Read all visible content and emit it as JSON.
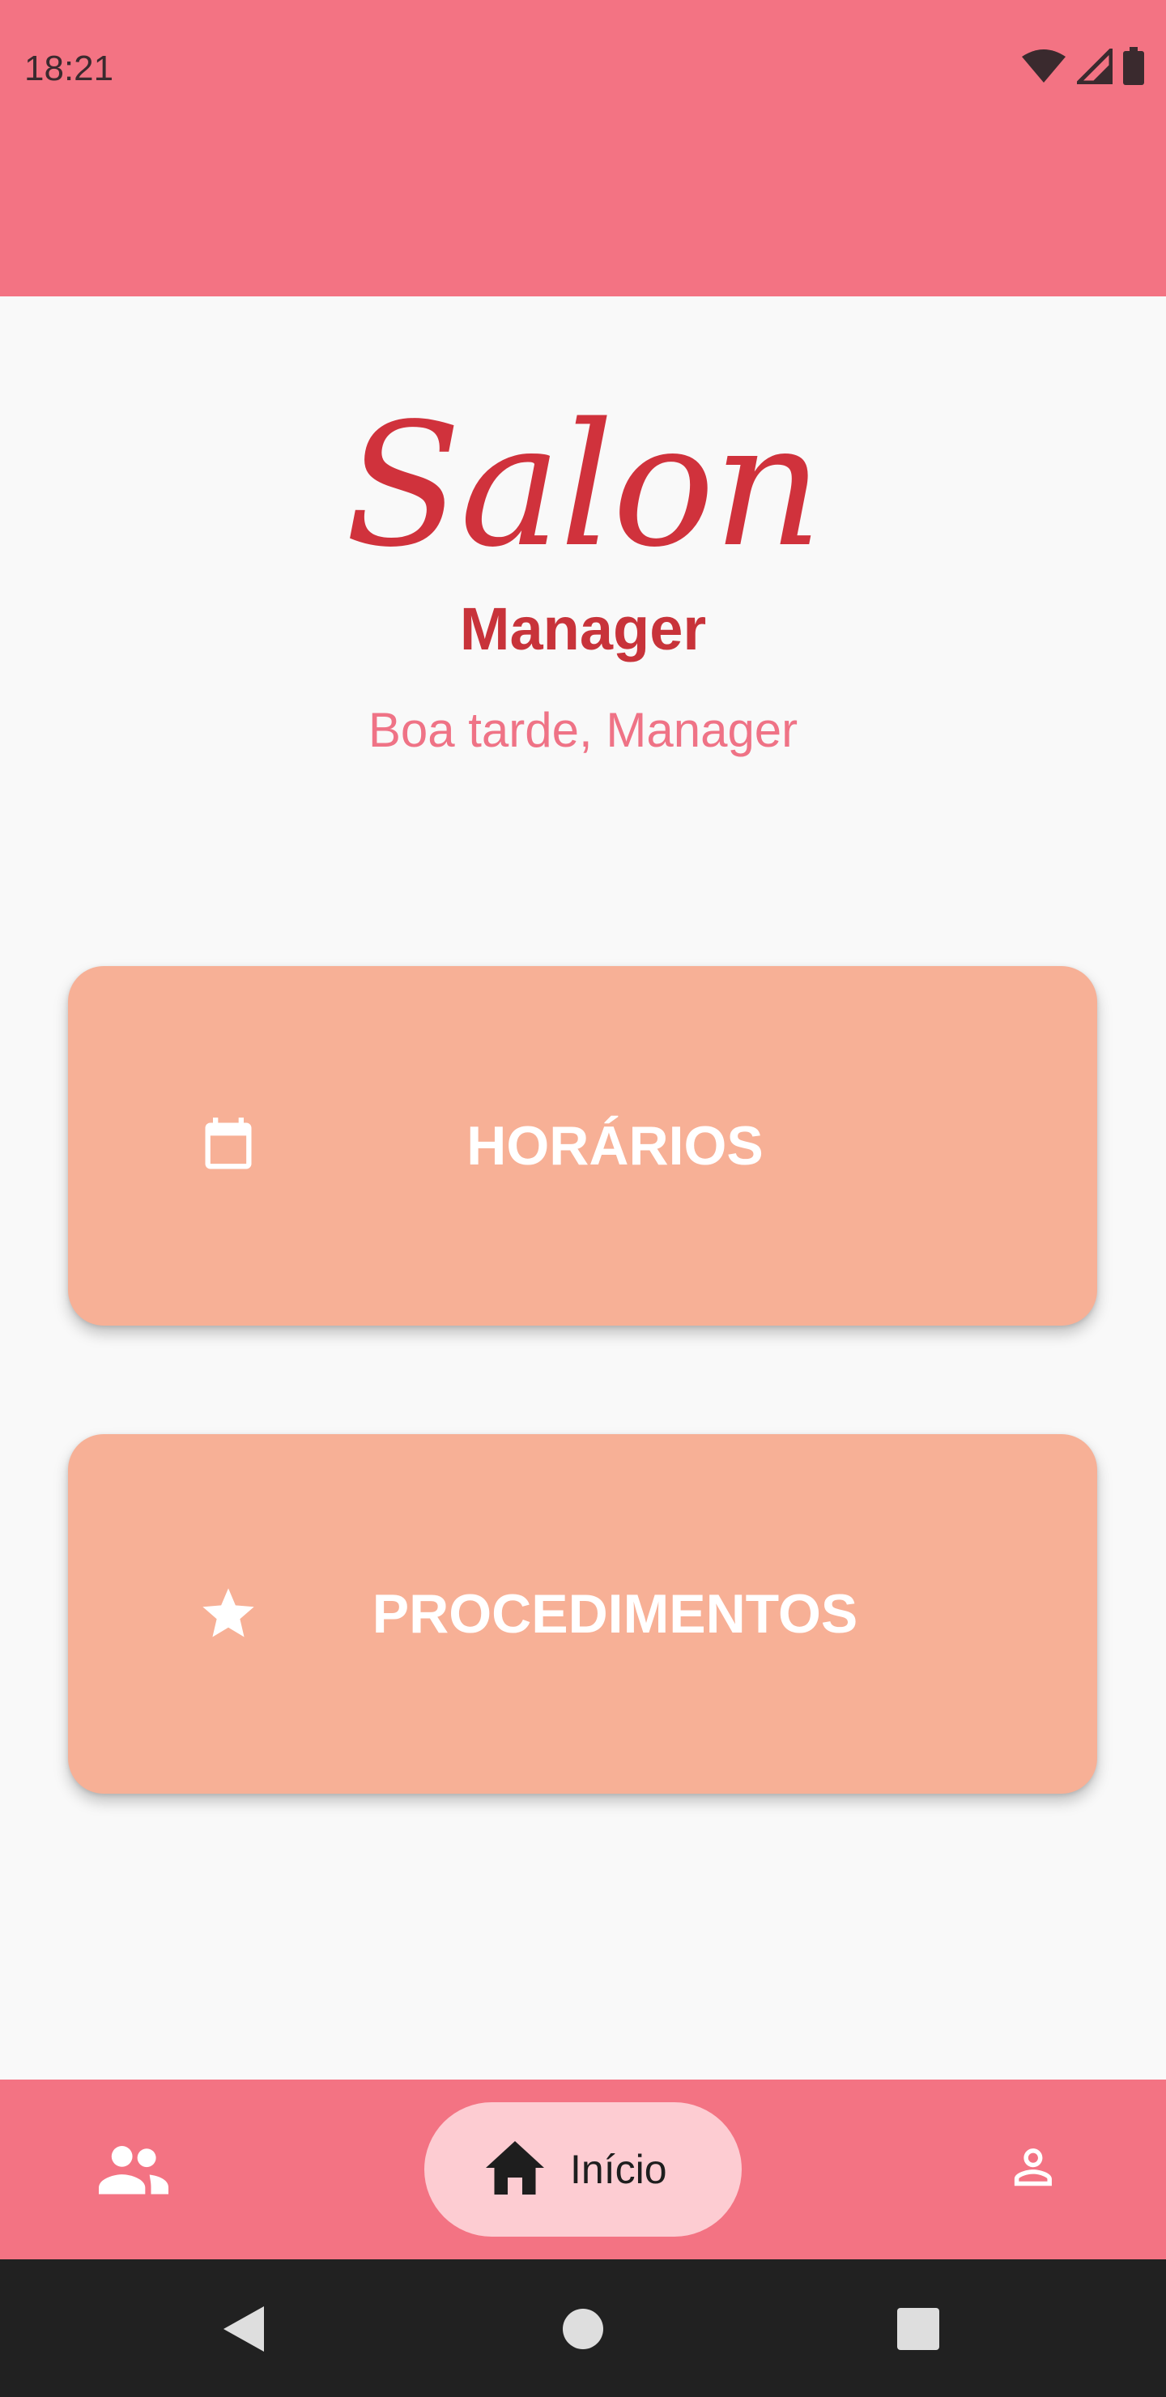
{
  "status_bar": {
    "time": "18:21",
    "icons": [
      "wifi-icon",
      "signal-icon",
      "battery-icon"
    ]
  },
  "header": {
    "logo_script": "Salon",
    "logo_sub": "Manager",
    "greeting": "Boa tarde, Manager"
  },
  "menu": {
    "items": [
      {
        "label": "HORÁRIOS",
        "icon": "calendar-icon"
      },
      {
        "label": "PROCEDIMENTOS",
        "icon": "star-icon"
      }
    ]
  },
  "bottom_nav": {
    "left_icon": "people-icon",
    "active_label": "Início",
    "active_icon": "home-icon",
    "right_icon": "person-icon"
  },
  "system_nav": {
    "buttons": [
      "back-icon",
      "home-circle-icon",
      "recents-icon"
    ]
  },
  "colors": {
    "primary": "#f37383",
    "logo": "#d0323c",
    "greeting": "#ef7386",
    "card": "#f7b096",
    "active_pill": "#fdccd2",
    "background": "#f9f9f9",
    "system_nav": "#212121"
  }
}
